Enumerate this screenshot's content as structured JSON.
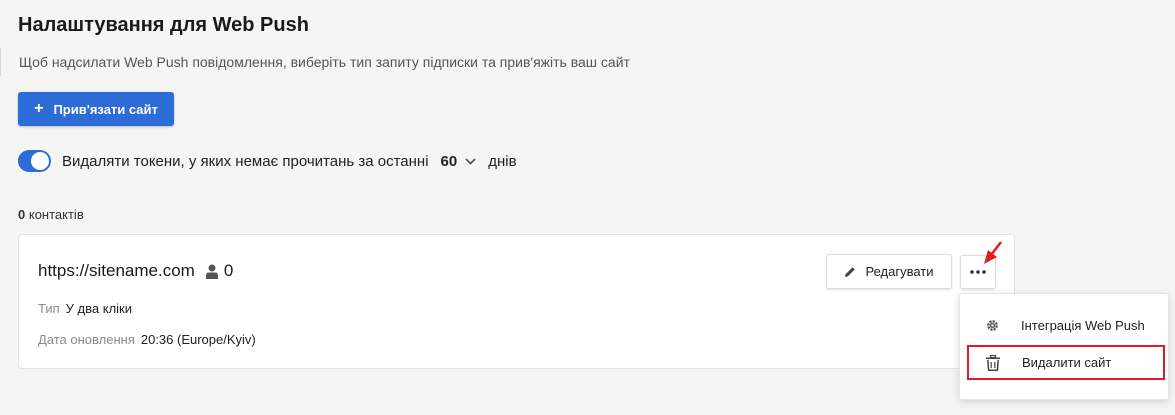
{
  "header": {
    "title": "Налаштування для Web Push",
    "subtitle": "Щоб надсилати Web Push повідомлення, виберіть тип запиту підписки та прив'яжіть ваш сайт"
  },
  "actions": {
    "link_site_label": "Прив'язати сайт",
    "link_site_icon": "plus-icon"
  },
  "token_setting": {
    "enabled": true,
    "label": "Видаляти токени, у яких немає прочитань за останні",
    "days_value": "60",
    "days_unit": "днів"
  },
  "contacts": {
    "count": "0",
    "label": "контактів"
  },
  "site_card": {
    "url": "https://sitename.com",
    "subscribers": "0",
    "type_label": "Тип",
    "type_value": "У два кліки",
    "updated_label": "Дата оновлення",
    "updated_value": "20:36 (Europe/Kyiv)",
    "edit_label": "Редагувати"
  },
  "more_menu": {
    "items": [
      {
        "label": "Інтеграція Web Push",
        "icon": "gear-icon"
      },
      {
        "label": "Видалити сайт",
        "icon": "trash-icon",
        "highlighted": true
      }
    ]
  },
  "colors": {
    "primary": "#2d6cd6",
    "annotation_red": "#e01b24",
    "background": "#f5f5f5"
  }
}
